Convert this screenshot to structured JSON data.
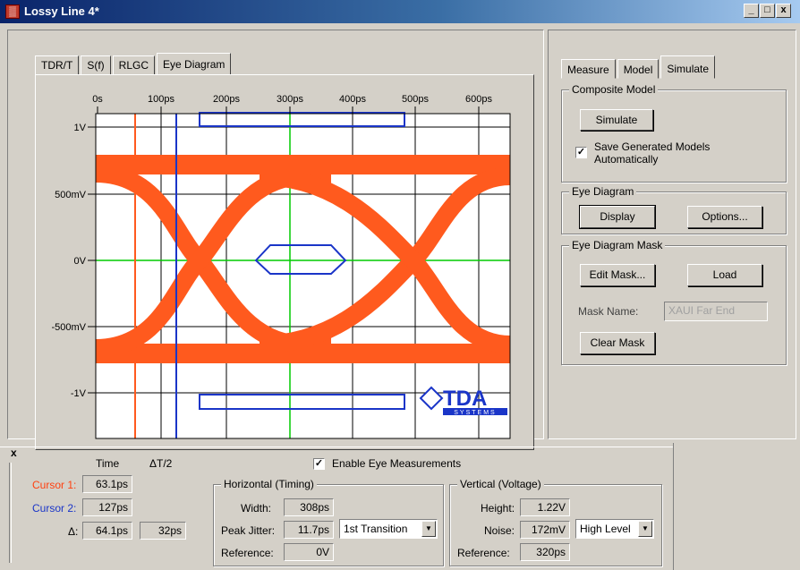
{
  "window": {
    "title": "Lossy Line 4*",
    "icon": "app-icon",
    "min": "_",
    "max": "□",
    "close": "x"
  },
  "left_tabs": [
    "TDR/T",
    "S(f)",
    "RLGC",
    "Eye Diagram"
  ],
  "right_tabs": [
    "Measure",
    "Model",
    "Simulate"
  ],
  "plot": {
    "x_ticks": [
      "0s",
      "100ps",
      "200ps",
      "300ps",
      "400ps",
      "500ps",
      "600ps"
    ],
    "y_ticks": [
      "1V",
      "500mV",
      "0V",
      "-500mV",
      "-1V"
    ],
    "logo": "TDA",
    "logo_sub": "SYSTEMS",
    "colors": {
      "eye": "#ff5a1e",
      "cursor1": "#ff5a1e",
      "cursor2": "#1a35c8",
      "mask": "#1a35c8",
      "axis_zero": "#00cc00"
    }
  },
  "composite_model": {
    "title": "Composite Model",
    "simulate_label": "Simulate",
    "save_checkbox_label_1": "Save Generated Models",
    "save_checkbox_label_2": "Automatically",
    "save_checked": "✓"
  },
  "eye_diagram": {
    "title": "Eye Diagram",
    "display_label": "Display",
    "options_label": "Options..."
  },
  "eye_mask": {
    "title": "Eye Diagram Mask",
    "edit_label": "Edit Mask...",
    "load_label": "Load",
    "mask_name_label": "Mask Name:",
    "mask_name_value": "XAUI Far End",
    "clear_label": "Clear Mask"
  },
  "bottom": {
    "close_icon": "x",
    "time_header": "Time",
    "delta_header": "ΔT/2",
    "cursor1_label": "Cursor 1:",
    "cursor1_time": "63.1ps",
    "cursor2_label": "Cursor 2:",
    "cursor2_time": "127ps",
    "delta_label": "Δ:",
    "delta_time": "64.1ps",
    "delta_half": "32ps",
    "enable_label": "Enable Eye Measurements",
    "enable_checked": "✓",
    "horizontal": {
      "title": "Horizontal (Timing)",
      "width_label": "Width:",
      "width_value": "308ps",
      "jitter_label": "Peak Jitter:",
      "jitter_value": "11.7ps",
      "jitter_select": "1st Transition",
      "reference_label": "Reference:",
      "reference_value": "0V"
    },
    "vertical": {
      "title": "Vertical (Voltage)",
      "height_label": "Height:",
      "height_value": "1.22V",
      "noise_label": "Noise:",
      "noise_value": "172mV",
      "noise_select": "High Level",
      "reference_label": "Reference:",
      "reference_value": "320ps"
    }
  }
}
